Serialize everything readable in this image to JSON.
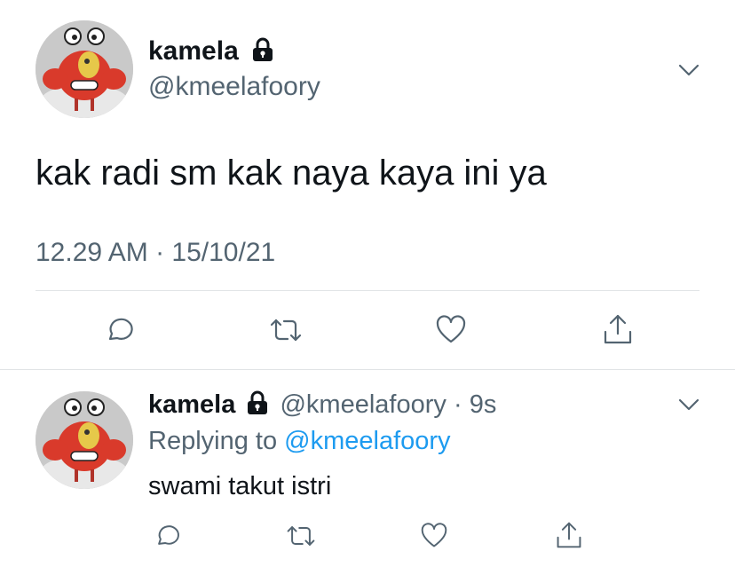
{
  "main_tweet": {
    "display_name": "kamela",
    "handle": "@kmeelafoory",
    "text": "kak radi sm kak naya kaya ini ya",
    "timestamp": "12.29 AM · 15/10/21",
    "avatar_icon": "crab-mascot-avatar",
    "protected_icon": "lock-icon"
  },
  "reply_tweet": {
    "display_name": "kamela",
    "handle": "@kmeelafoory",
    "separator": "·",
    "age": "9s",
    "replying_prefix": "Replying to",
    "replying_to": "@kmeelafoory",
    "text": "swami takut istri"
  },
  "actions": {
    "icons": [
      "reply-icon",
      "retweet-icon",
      "like-icon",
      "share-icon"
    ]
  },
  "colors": {
    "text": "#0f1419",
    "muted": "#536471",
    "link": "#1d9bf0",
    "divider": "#e1e4e6"
  }
}
